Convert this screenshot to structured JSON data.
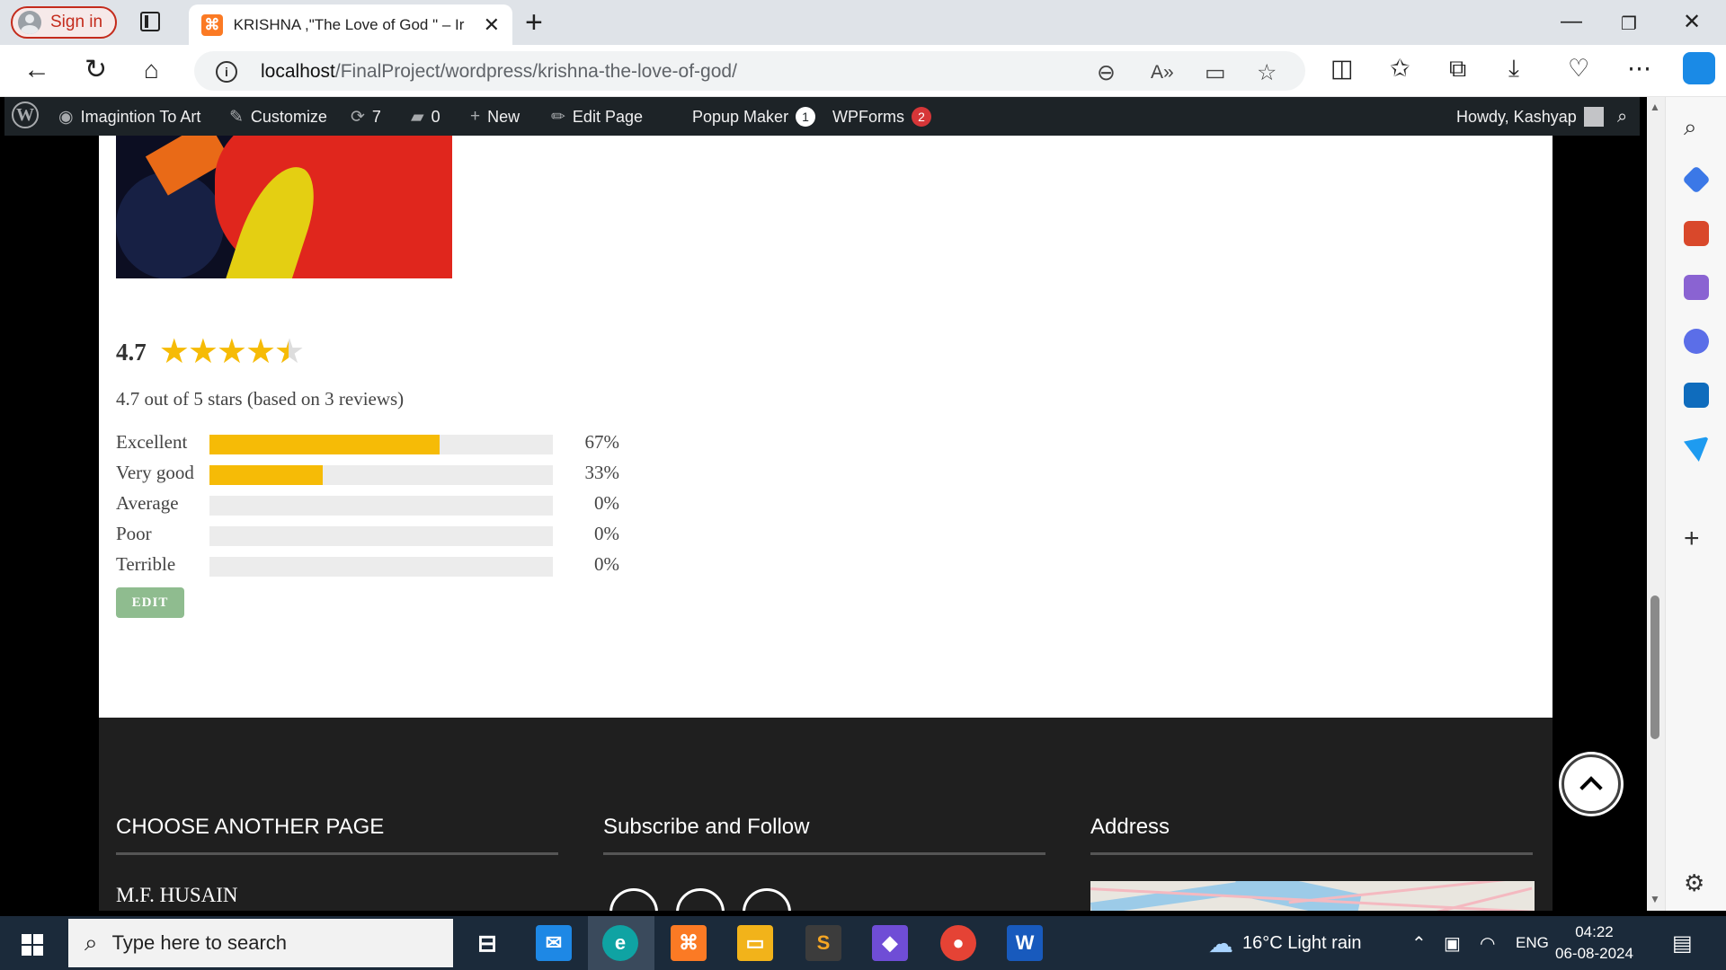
{
  "browser": {
    "signin_label": "Sign in",
    "tab_title": "KRISHNA ,\"The Love of God \" – Ir",
    "url_host": "localhost",
    "url_path": "/FinalProject/wordpress/krishna-the-love-of-god/"
  },
  "wp_admin_bar": {
    "site_name": "Imagintion To Art",
    "customize": "Customize",
    "updates_count": "7",
    "comments_count": "0",
    "new_label": "New",
    "edit_page": "Edit Page",
    "popup_maker": "Popup Maker",
    "popup_maker_badge": "1",
    "wpforms": "WPForms",
    "wpforms_badge": "2",
    "howdy": "Howdy, Kashyap"
  },
  "rating": {
    "average": "4.7",
    "stars_full": 4,
    "stars_half": 1,
    "summary": "4.7 out of 5 stars (based on 3 reviews)",
    "distribution": [
      {
        "label": "Excellent",
        "percent": 67,
        "percent_text": "67%"
      },
      {
        "label": "Very good",
        "percent": 33,
        "percent_text": "33%"
      },
      {
        "label": "Average",
        "percent": 0,
        "percent_text": "0%"
      },
      {
        "label": "Poor",
        "percent": 0,
        "percent_text": "0%"
      },
      {
        "label": "Terrible",
        "percent": 0,
        "percent_text": "0%"
      }
    ],
    "edit_label": "EDIT",
    "bar_color": "#f6bb06"
  },
  "footer": {
    "col1_title": "CHOOSE ANOTHER PAGE",
    "col1_first_item": "M.F. HUSAIN",
    "col2_title": "Subscribe and Follow",
    "col3_title": "Address",
    "social_icons": [
      "youtube-icon",
      "instagram-icon",
      "facebook-icon"
    ]
  },
  "taskbar": {
    "search_placeholder": "Type here to search",
    "weather": "16°C  Light rain",
    "language": "ENG",
    "time": "04:22",
    "date": "06-08-2024"
  }
}
